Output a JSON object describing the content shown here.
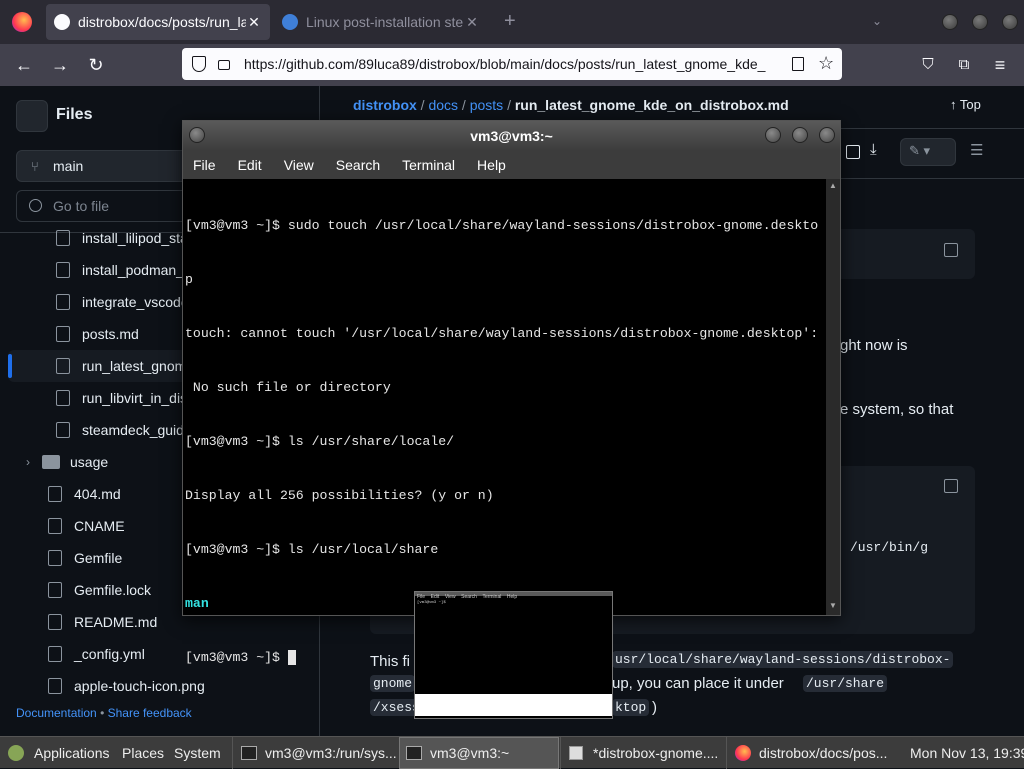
{
  "browser": {
    "tabs": [
      {
        "label": "distrobox/docs/posts/run_la",
        "active": true
      },
      {
        "label": "Linux post-installation ste",
        "active": false
      }
    ],
    "url": "https://github.com/89luca89/distrobox/blob/main/docs/posts/run_latest_gnome_kde_",
    "new_tab": "+"
  },
  "github": {
    "files_title": "Files",
    "branch": "main",
    "goto_placeholder": "Go to file",
    "breadcrumb": {
      "repo": "distrobox",
      "sep": "/",
      "dir1": "docs",
      "dir2": "posts",
      "file": "run_latest_gnome_kde_on_distrobox.md"
    },
    "top_label": "Top",
    "tree": [
      {
        "label": "install_lilipod_sta",
        "type": "file"
      },
      {
        "label": "install_podman_",
        "type": "file"
      },
      {
        "label": "integrate_vscode",
        "type": "file"
      },
      {
        "label": "posts.md",
        "type": "file"
      },
      {
        "label": "run_latest_gnom",
        "type": "file",
        "selected": true
      },
      {
        "label": "run_libvirt_in_dis",
        "type": "file"
      },
      {
        "label": "steamdeck_guid",
        "type": "file"
      },
      {
        "label": "usage",
        "type": "folder"
      },
      {
        "label": "404.md",
        "type": "file"
      },
      {
        "label": "CNAME",
        "type": "file"
      },
      {
        "label": "Gemfile",
        "type": "file"
      },
      {
        "label": "Gemfile.lock",
        "type": "file"
      },
      {
        "label": "README.md",
        "type": "file"
      },
      {
        "label": "_config.yml",
        "type": "file"
      },
      {
        "label": "apple-touch-icon.png",
        "type": "file"
      }
    ],
    "footer": {
      "documentation": "Documentation",
      "bullet": "•",
      "feedback": "Share feedback"
    },
    "content": {
      "frag1": "ght now is",
      "frag2": "e system, so that",
      "code_frag": "/usr/bin/g",
      "para_start": "This fi",
      "code1": "usr/local/share/wayland-sessions/distrobox-",
      "code2": "gnome",
      "mid": "up, you can place it under",
      "code3": "/usr/share",
      "code4": "/xsess",
      "code5": "ktop",
      "close_paren": ")"
    }
  },
  "terminal": {
    "title": "vm3@vm3:~",
    "menu": [
      "File",
      "Edit",
      "View",
      "Search",
      "Terminal",
      "Help"
    ],
    "lines": [
      "[vm3@vm3 ~]$ sudo touch /usr/local/share/wayland-sessions/distrobox-gnome.deskto",
      "p",
      "touch: cannot touch '/usr/local/share/wayland-sessions/distrobox-gnome.desktop':",
      " No such file or directory",
      "[vm3@vm3 ~]$ ls /usr/share/locale/",
      "Display all 256 possibilities? (y or n)",
      "[vm3@vm3 ~]$ ls /usr/local/share"
    ],
    "dir_output": "man",
    "prompt": "[vm3@vm3 ~]$ "
  },
  "thumbnail": {
    "menu": [
      "File",
      "Edit",
      "View",
      "Search",
      "Terminal",
      "Help"
    ],
    "line": "[vm3@vm3 ~]$"
  },
  "taskbar": {
    "applications": "Applications",
    "places": "Places",
    "system": "System",
    "windows": [
      {
        "label": "vm3@vm3:/run/sys..."
      },
      {
        "label": "vm3@vm3:~",
        "active": true
      },
      {
        "label": "*distrobox-gnome...."
      },
      {
        "label": "distrobox/docs/pos..."
      }
    ],
    "clock": "Mon Nov 13, 19:39"
  },
  "colors": {
    "link": "#4493f8",
    "dir_output": "#34e2e2",
    "selected_bar": "#1f6feb"
  }
}
